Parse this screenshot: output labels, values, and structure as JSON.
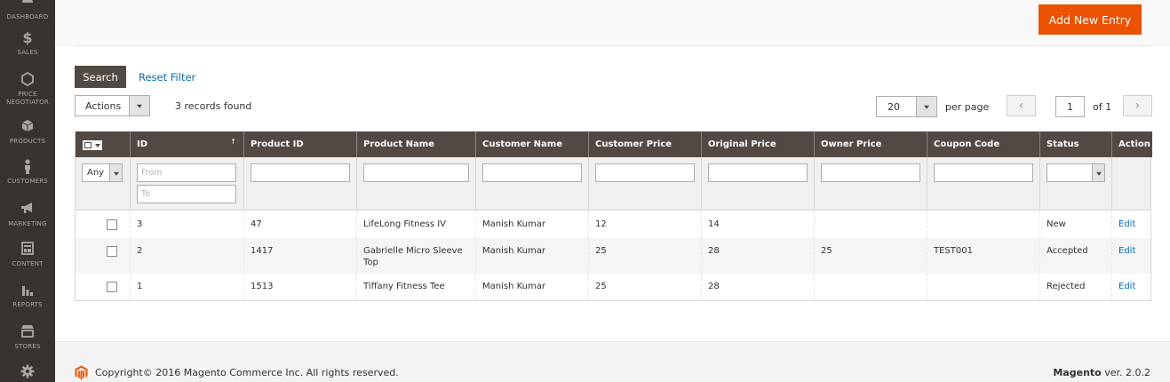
{
  "sidebar": {
    "items": [
      {
        "label": "DASHBOARD",
        "icon": "dashboard-icon"
      },
      {
        "label": "SALES",
        "icon": "dollar-icon"
      },
      {
        "label": "PRICE NEGOTIATOR",
        "icon": "hexagon-icon"
      },
      {
        "label": "PRODUCTS",
        "icon": "cube-icon"
      },
      {
        "label": "CUSTOMERS",
        "icon": "person-icon"
      },
      {
        "label": "MARKETING",
        "icon": "megaphone-icon"
      },
      {
        "label": "CONTENT",
        "icon": "layout-icon"
      },
      {
        "label": "REPORTS",
        "icon": "bar-chart-icon"
      },
      {
        "label": "STORES",
        "icon": "store-icon"
      },
      {
        "label": "",
        "icon": "gear-icon"
      }
    ]
  },
  "header": {
    "add_button": "Add New Entry"
  },
  "toolbar": {
    "search_button": "Search",
    "reset_filter": "Reset Filter",
    "actions_label": "Actions",
    "records_found": "3 records found",
    "per_page_value": "20",
    "per_page_label": "per page",
    "page_value": "1",
    "page_of": "of 1"
  },
  "grid": {
    "columns": [
      "ID",
      "Product ID",
      "Product Name",
      "Customer Name",
      "Customer Price",
      "Original Price",
      "Owner Price",
      "Coupon Code",
      "Status",
      "Action"
    ],
    "filters": {
      "any_label": "Any",
      "id_from_placeholder": "From",
      "id_to_placeholder": "To"
    },
    "rows": [
      {
        "id": "3",
        "product_id": "47",
        "product_name": "LifeLong Fitness IV",
        "customer_name": "Manish Kumar",
        "customer_price": "12",
        "original_price": "14",
        "owner_price": "",
        "coupon_code": "",
        "status": "New",
        "action": "Edit"
      },
      {
        "id": "2",
        "product_id": "1417",
        "product_name": "Gabrielle Micro Sleeve Top",
        "customer_name": "Manish Kumar",
        "customer_price": "25",
        "original_price": "28",
        "owner_price": "25",
        "coupon_code": "TEST001",
        "status": "Accepted",
        "action": "Edit"
      },
      {
        "id": "1",
        "product_id": "1513",
        "product_name": "Tiffany Fitness Tee",
        "customer_name": "Manish Kumar",
        "customer_price": "25",
        "original_price": "28",
        "owner_price": "",
        "coupon_code": "",
        "status": "Rejected",
        "action": "Edit"
      }
    ]
  },
  "footer": {
    "copyright": "Copyright© 2016 Magento Commerce Inc. All rights reserved.",
    "brand": "Magento",
    "version": " ver. 2.0.2"
  },
  "colors": {
    "accent": "#eb5202",
    "sidebar": "#373330",
    "grid_header": "#514943",
    "link": "#006bb4"
  }
}
